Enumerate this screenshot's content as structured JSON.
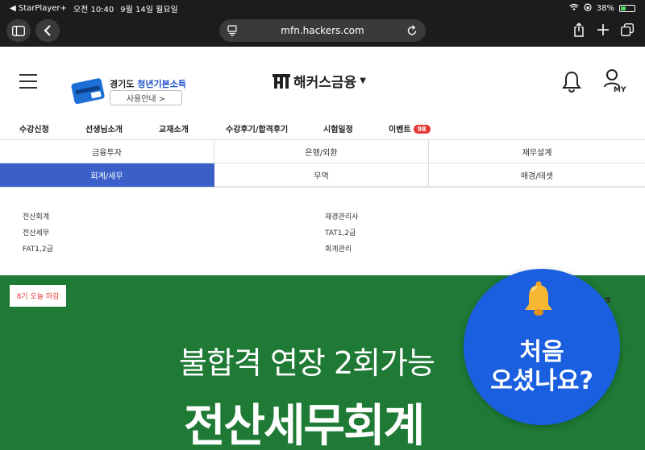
{
  "status_bar": {
    "back_app": "◀ StarPlayer+",
    "time": "오전 10:40",
    "date": "9월 14일 월요일",
    "battery_text": "38%",
    "battery_level": 0.38
  },
  "browser": {
    "url": "mfn.hackers.com",
    "icons": [
      "sidebar-icon",
      "back-icon",
      "reader-icon",
      "reload-icon",
      "share-icon",
      "add-tab-icon",
      "tabs-icon"
    ]
  },
  "header": {
    "promo": {
      "region": "경기도",
      "title": "청년기본소득",
      "button": "사용안내 >"
    },
    "logo": {
      "text": "해커스금융",
      "caret": "▼"
    },
    "icons": [
      "menu-icon",
      "bell-icon",
      "my-page-icon"
    ]
  },
  "nav": {
    "items": [
      {
        "label": "수강신청"
      },
      {
        "label": "선생님소개"
      },
      {
        "label": "교재소개"
      },
      {
        "label": "수강후기/합격후기"
      },
      {
        "label": "시험일정"
      },
      {
        "label": "이벤트",
        "badge": "98"
      }
    ],
    "badge_color": "#e53935"
  },
  "categories": [
    {
      "label": "금융투자",
      "active": false
    },
    {
      "label": "은행/외환",
      "active": false
    },
    {
      "label": "재무설계",
      "active": false
    },
    {
      "label": "회계/세무",
      "active": true
    },
    {
      "label": "무역",
      "active": false
    },
    {
      "label": "매경/테셋",
      "active": false
    }
  ],
  "active_color": "#3a5fc8",
  "subcategories": {
    "left": [
      "전산회계",
      "전산세무",
      "FAT1,2급"
    ],
    "right": [
      "재경관리사",
      "TAT1,2급",
      "회계관리"
    ]
  },
  "banner": {
    "tag": "8기 오늘 마감",
    "page": "2/5",
    "line1": "불합격 연장 2회가능",
    "line2": "전산세무회계",
    "color": "#1f7a35"
  },
  "bubble": {
    "line1": "처음",
    "line2": "오셨나요?",
    "color": "#1a5fe0"
  }
}
